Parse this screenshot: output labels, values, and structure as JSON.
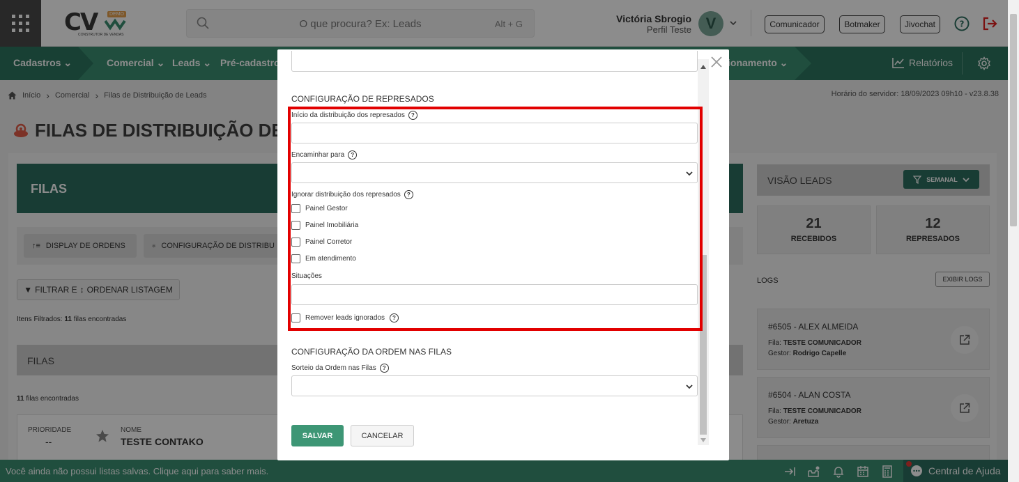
{
  "header": {
    "logo_text": "CV",
    "logo_badge": "DEMO",
    "logo_subtitle": "CONSTRUTOR DE VENDAS",
    "search_placeholder": "O que procura? Ex: Leads",
    "search_shortcut": "Alt + G",
    "user_name": "Victória Sbrogio",
    "user_role": "Perfil Teste",
    "avatar_letter": "V",
    "buttons": [
      "Comunicador",
      "Botmaker",
      "Jivochat"
    ]
  },
  "nav": {
    "items": [
      "Cadastros",
      "Comercial",
      "Leads",
      "Pré-cadastros"
    ],
    "partial_item": "ionamento",
    "reports": "Relatórios"
  },
  "breadcrumb": [
    "Início",
    "Comercial",
    "Filas de Distribuição de Leads"
  ],
  "server_time": "Horário do servidor: 18/09/2023 09h10 - v23.8.38",
  "page_title": "FILAS DE DISTRIBUIÇÃO DE L",
  "left": {
    "filas_header": "FILAS",
    "tool_display": "DISPLAY DE ORDENS",
    "tool_config": "CONFIGURAÇÃO DE DISTRIBU",
    "filter_label": "FILTRAR E",
    "order_label": "ORDENAR LISTAGEM",
    "items_filtered_prefix": "Itens Filtrados:",
    "items_filtered_count": "11",
    "items_filtered_suffix": "filas encontradas",
    "filas_bar": "FILAS",
    "found_count": "11",
    "found_suffix": "filas encontradas",
    "card": {
      "priority_label": "PRIORIDADE",
      "priority_value": "--",
      "name_label": "NOME",
      "name_value": "TESTE CONTAKO"
    }
  },
  "right": {
    "header": "VISÃO LEADS",
    "period_button": "SEMANAL",
    "stats": [
      {
        "value": "21",
        "label": "RECEBIDOS"
      },
      {
        "value": "12",
        "label": "REPRESADOS"
      }
    ],
    "logs_title": "LOGS",
    "logs_button": "EXIBIR LOGS",
    "logs": [
      {
        "title": "#6505 - ALEX ALMEIDA",
        "fila_label": "Fila:",
        "fila": "TESTE COMUNICADOR",
        "gestor_label": "Gestor:",
        "gestor": "Rodrigo Capelle"
      },
      {
        "title": "#6504 - ALAN COSTA",
        "fila_label": "Fila:",
        "fila": "TESTE COMUNICADOR",
        "gestor_label": "Gestor:",
        "gestor": "Aretuza"
      }
    ]
  },
  "bottom": {
    "message": "Você ainda não possui listas salvas. Clique aqui para saber mais.",
    "help_center": "Central de Ajuda"
  },
  "modal": {
    "section_represados": "CONFIGURAÇÃO DE REPRESADOS",
    "inicio_label": "Início da distribuição dos represados",
    "inicio_value": "",
    "encaminhar_label": "Encaminhar para",
    "encaminhar_value": "",
    "ignorar_label": "Ignorar distribuição dos represados",
    "checks": [
      "Painel Gestor",
      "Painel Imobiliária",
      "Painel Corretor",
      "Em atendimento"
    ],
    "situacoes_label": "Situações",
    "situacoes_value": "",
    "remover_label": "Remover leads ignorados",
    "section_ordem": "CONFIGURAÇÃO DA ORDEM NAS FILAS",
    "sorteio_label": "Sorteio da Ordem nas Filas",
    "sorteio_value": "",
    "save": "SALVAR",
    "cancel": "CANCELAR"
  },
  "colors": {
    "brand_green": "#3b8f72",
    "dark_green": "#2d6e5f",
    "highlight_red": "#e20000"
  }
}
